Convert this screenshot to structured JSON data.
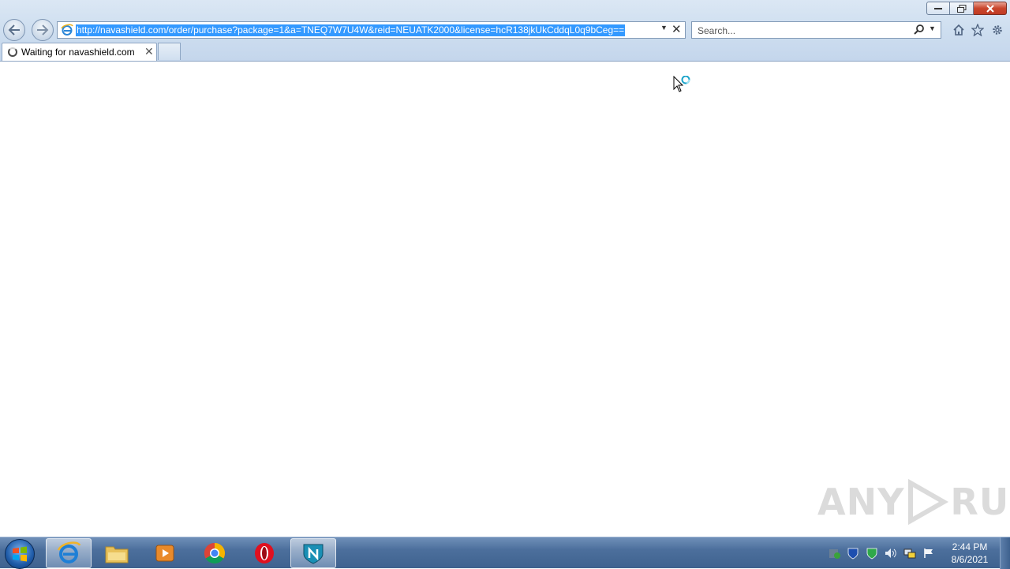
{
  "browser": {
    "address_url": "http://navashield.com/order/purchase?package=1&a=TNEQ7W7U4W&reid=NEUATK2000&license=hcR138jkUkCddqL0q9bCeg==",
    "search_placeholder": "Search...",
    "tab_title": "Waiting for navashield.com",
    "icons": [
      "back-icon",
      "forward-icon",
      "ie-page-icon",
      "dropdown-icon",
      "stop-icon",
      "search-icon",
      "home-icon",
      "favorites-star-icon",
      "gear-icon"
    ]
  },
  "watermark": {
    "part1": "ANY",
    "part2": "RUN"
  },
  "taskbar": {
    "apps": [
      "internet-explorer",
      "file-explorer",
      "media-player",
      "chrome",
      "opera",
      "navashield"
    ],
    "tray_icons": [
      "security-icon",
      "shield-icon",
      "green-shield-icon",
      "volume-icon",
      "network-icon",
      "flag-icon"
    ],
    "time": "2:44 PM",
    "date": "8/6/2021"
  },
  "colors": {
    "url_highlight": "#3399ff",
    "chrome_bg": "#cfdff0",
    "taskbar_bg": "#4c6f9c"
  }
}
